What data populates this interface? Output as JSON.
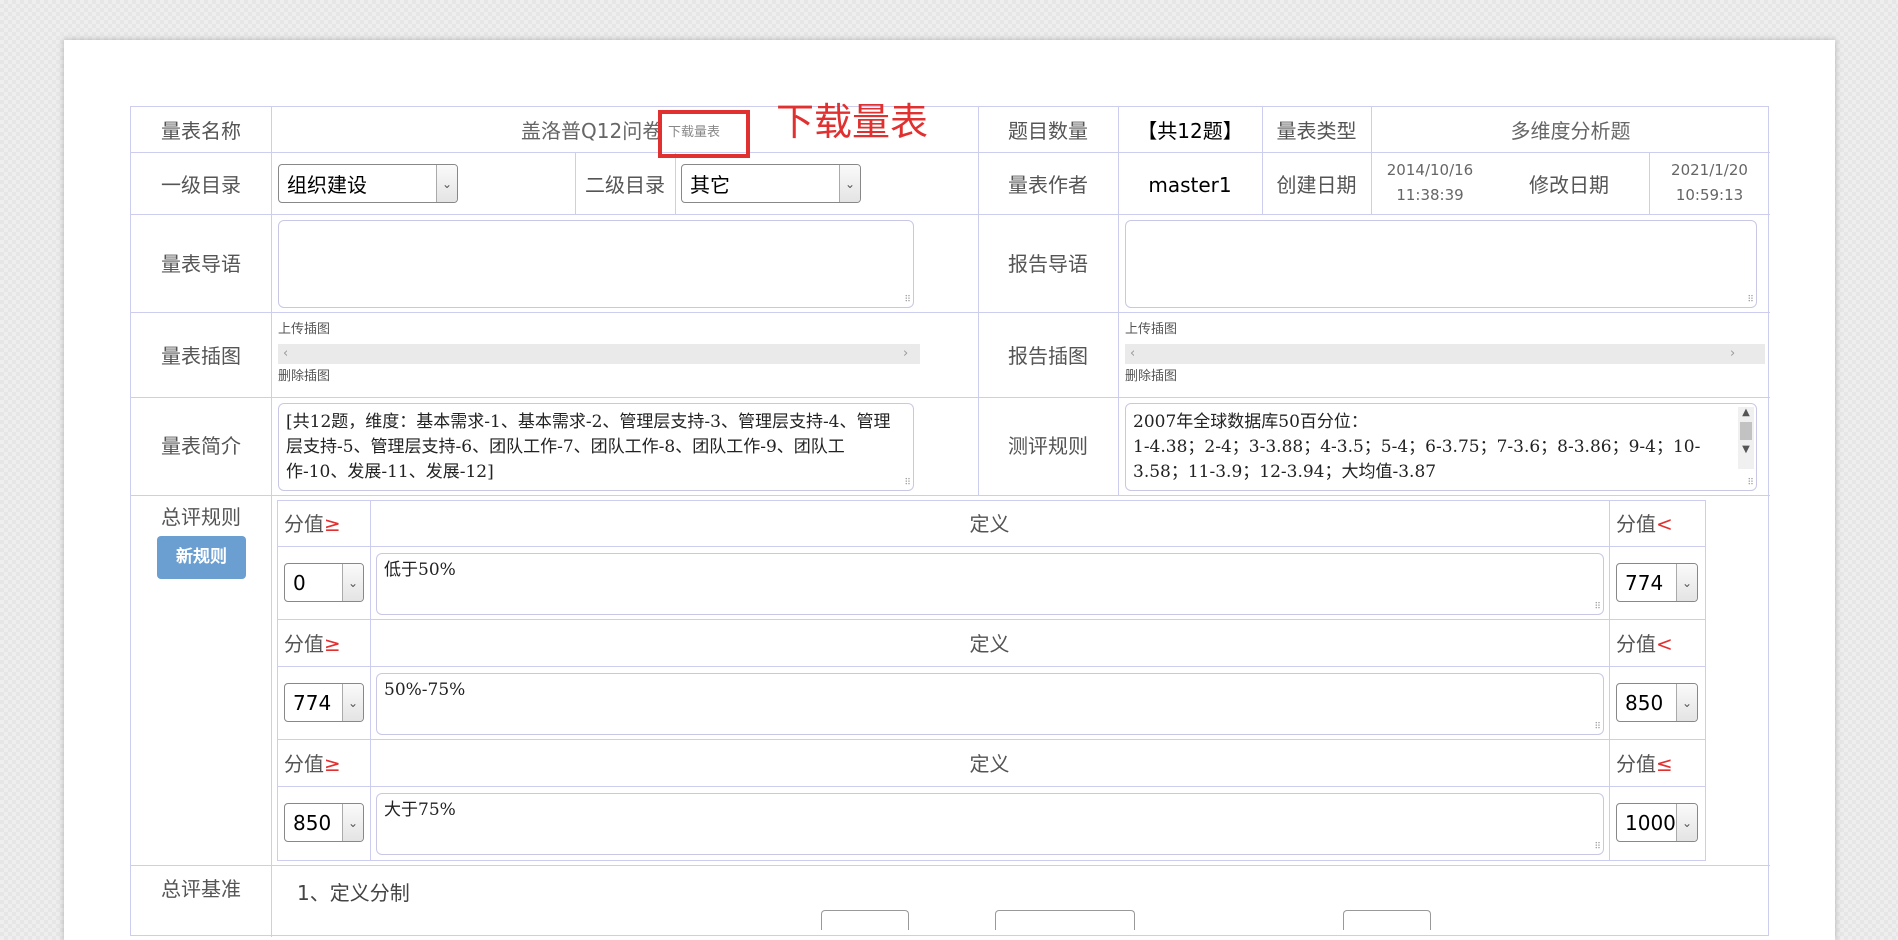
{
  "form": {
    "scale_name_label": "量表名称",
    "scale_name_value": "盖洛普Q12问卷",
    "download_link": "下载量表",
    "annotation_text": "下载量表",
    "question_count_label": "题目数量",
    "question_count_value": "【共12题】",
    "scale_type_label": "量表类型",
    "scale_type_value": "多维度分析题",
    "cat1_label": "一级目录",
    "cat1_value": "组织建设",
    "cat2_label": "二级目录",
    "cat2_value": "其它",
    "author_label": "量表作者",
    "author_value": "master1",
    "created_label": "创建日期",
    "created_date": "2014/10/16",
    "created_time": "11:38:39",
    "modified_label": "修改日期",
    "modified_date": "2021/1/20",
    "modified_time": "10:59:13",
    "intro_label": "量表导语",
    "report_intro_label": "报告导语",
    "illus_label": "量表插图",
    "report_illus_label": "报告插图",
    "upload_illus": "上传插图",
    "delete_illus": "删除插图",
    "summary_label": "量表简介",
    "summary_text": "[共12题，维度：基本需求-1、基本需求-2、管理层支持-3、管理层支持-4、管理层支持-5、管理层支持-6、团队工作-7、团队工作-8、团队工作-9、团队工作-10、发展-11、发展-12]",
    "rules_label": "测评规则",
    "rules_text_line1": "2007年全球数据库50百分位：",
    "rules_text_line2": "1-4.38；2-4；3-3.88；4-3.5；5-4；6-3.75；7-3.6；8-3.86；9-4；10-3.58；11-3.9；12-3.94；大均值-3.87",
    "overall_rules_label": "总评规则",
    "new_rule_button": "新规则",
    "overall_basis_label": "总评基准",
    "basis_item1": "1、定义分制"
  },
  "rules": [
    {
      "min_label": "分值",
      "min_op": "≥",
      "def_header": "定义",
      "max_label": "分值",
      "max_op": "<",
      "min_value": "0",
      "definition": "低于50%",
      "max_value": "774"
    },
    {
      "min_label": "分值",
      "min_op": "≥",
      "def_header": "定义",
      "max_label": "分值",
      "max_op": "<",
      "min_value": "774",
      "definition": "50%-75%",
      "max_value": "850"
    },
    {
      "min_label": "分值",
      "min_op": "≥",
      "def_header": "定义",
      "max_label": "分值",
      "max_op": "≤",
      "min_value": "850",
      "definition": "大于75%",
      "max_value": "1000"
    }
  ],
  "colors": {
    "annotation_red": "#e0302f",
    "button_blue": "#6b9fd2",
    "border": "#cdcdf0"
  }
}
